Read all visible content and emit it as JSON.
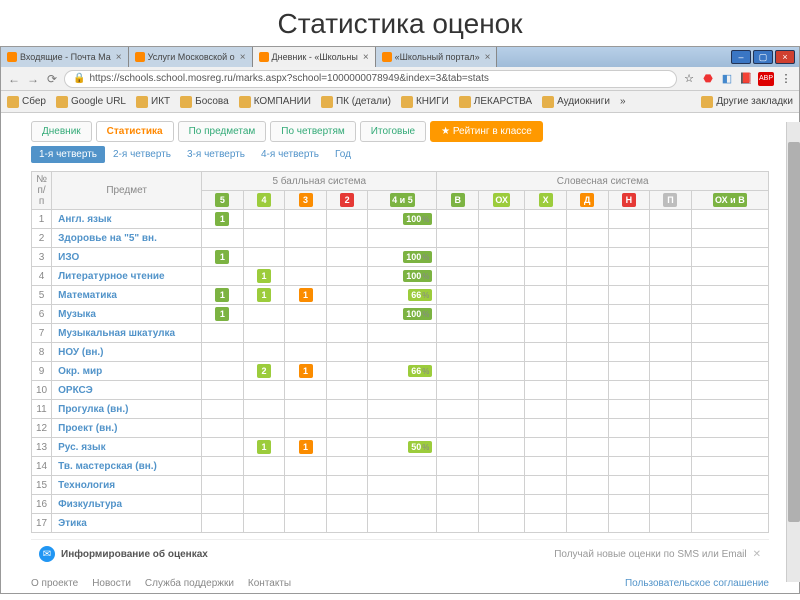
{
  "slide_title": "Статистика оценок",
  "browser": {
    "tabs": [
      {
        "label": "Входящие - Почта Ма"
      },
      {
        "label": "Услуги Московской о"
      },
      {
        "label": "Дневник - «Школьны",
        "active": true
      },
      {
        "label": "«Школьный портал»"
      }
    ],
    "url": "https://schools.school.mosreg.ru/marks.aspx?school=1000000078949&index=3&tab=stats",
    "bookmarks": [
      "Сбер",
      "Google URL",
      "ИКТ",
      "Босова",
      "КОМПАНИИ",
      "ПК (детали)",
      "КНИГИ",
      "ЛЕКАРСТВА",
      "Аудиокниги"
    ],
    "bookmark_more": "»",
    "bookmark_other": "Другие закладки"
  },
  "pageTabs": [
    {
      "label": "Дневник"
    },
    {
      "label": "Статистика",
      "sel": true
    },
    {
      "label": "По предметам"
    },
    {
      "label": "По четвертям"
    },
    {
      "label": "Итоговые"
    },
    {
      "label": "Рейтинг в классе",
      "orange": true,
      "icon": "★"
    }
  ],
  "quarterTabs": [
    {
      "label": "1-я четверть",
      "on": true
    },
    {
      "label": "2-я четверть"
    },
    {
      "label": "3-я четверть"
    },
    {
      "label": "4-я четверть"
    },
    {
      "label": "Год"
    }
  ],
  "headers": {
    "num": "№ п/п",
    "subj": "Предмет",
    "sys5": "5 балльная система",
    "verb": "Словесная система",
    "g5": "5",
    "g4": "4",
    "g3": "3",
    "g2": "2",
    "g45": "4 и 5",
    "v_B": "В",
    "v_OX": "ОХ",
    "v_X": "Х",
    "v_D": "Д",
    "v_H": "Н",
    "v_P": "П",
    "v_OXB": "ОХ и В"
  },
  "rows": [
    {
      "n": 1,
      "subj": "Англ. язык",
      "c5": "1",
      "pct": "100"
    },
    {
      "n": 2,
      "subj": "Здоровье на \"5\" вн."
    },
    {
      "n": 3,
      "subj": "ИЗО",
      "c5": "1",
      "pct": "100"
    },
    {
      "n": 4,
      "subj": "Литературное чтение",
      "c4": "1",
      "pct": "100"
    },
    {
      "n": 5,
      "subj": "Математика",
      "c5": "1",
      "c4": "1",
      "c3": "1",
      "pct": "66",
      "mid": true
    },
    {
      "n": 6,
      "subj": "Музыка",
      "c5": "1",
      "pct": "100"
    },
    {
      "n": 7,
      "subj": "Музыкальная шкатулка"
    },
    {
      "n": 8,
      "subj": "НОУ (вн.)"
    },
    {
      "n": 9,
      "subj": "Окр. мир",
      "c4": "2",
      "c3": "1",
      "pct": "66",
      "mid": true
    },
    {
      "n": 10,
      "subj": "ОРКСЭ"
    },
    {
      "n": 11,
      "subj": "Прогулка (вн.)"
    },
    {
      "n": 12,
      "subj": "Проект (вн.)"
    },
    {
      "n": 13,
      "subj": "Рус. язык",
      "c4": "1",
      "c3": "1",
      "pct": "50",
      "mid": true
    },
    {
      "n": 14,
      "subj": "Тв. мастерская (вн.)"
    },
    {
      "n": 15,
      "subj": "Технология"
    },
    {
      "n": 16,
      "subj": "Физкультура"
    },
    {
      "n": 17,
      "subj": "Этика"
    }
  ],
  "notif": {
    "title": "Информирование об оценках",
    "sub": "Получай новые оценки по SMS или Email"
  },
  "footer": [
    "О проекте",
    "Новости",
    "Служба поддержки",
    "Контакты"
  ],
  "footer_right": "Пользовательское соглашение"
}
